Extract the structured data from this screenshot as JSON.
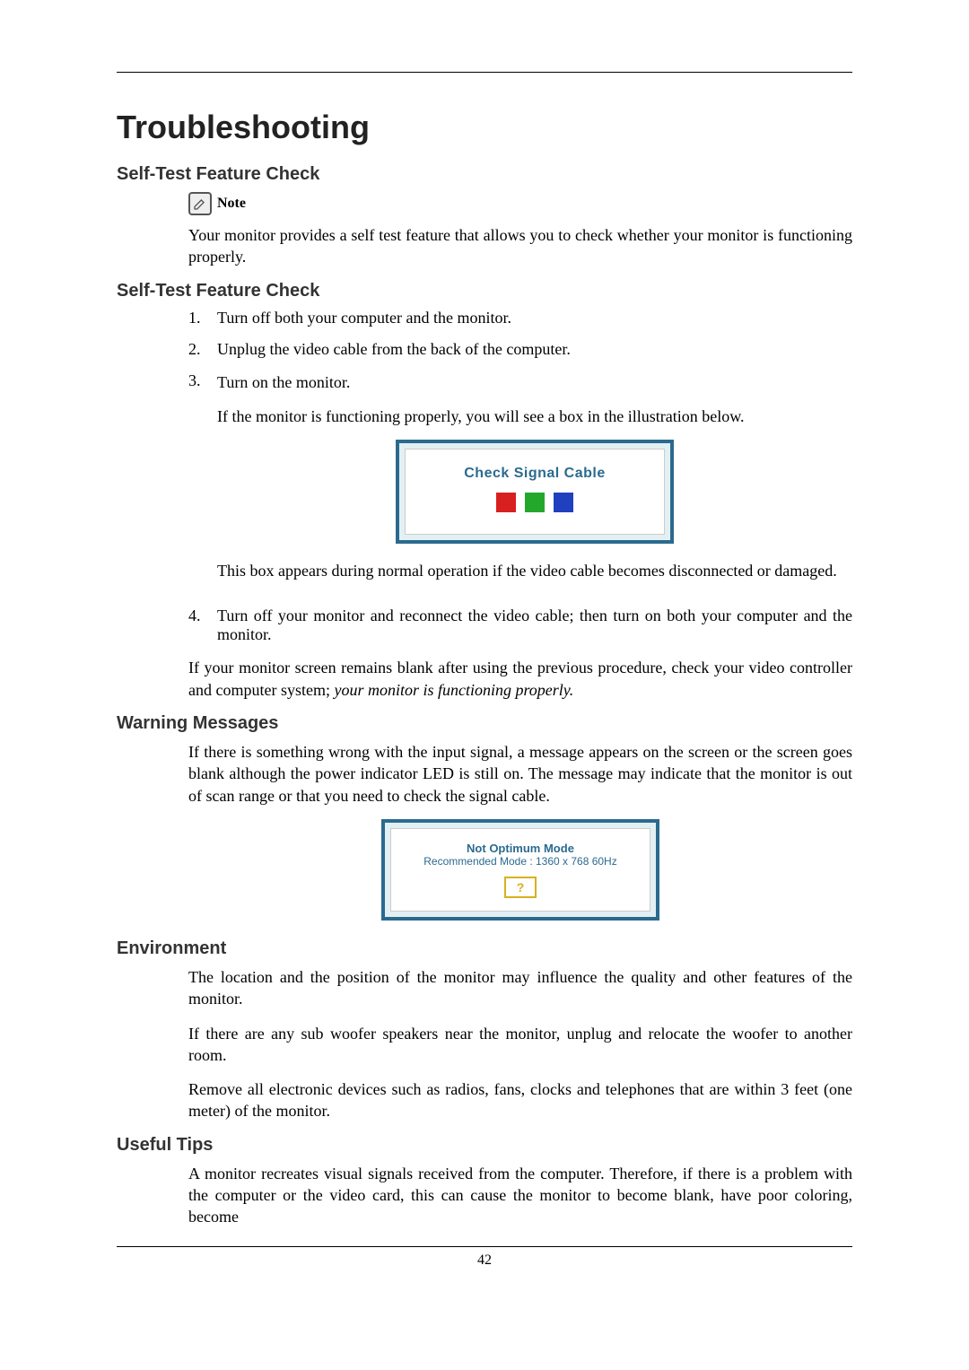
{
  "page": {
    "title": "Troubleshooting",
    "page_number": "42"
  },
  "sections": {
    "s1": {
      "heading": "Self-Test Feature Check",
      "note_label": "Note",
      "note_text": "Your monitor provides a self test feature that allows you to check whether your monitor is functioning properly."
    },
    "s2": {
      "heading": "Self-Test Feature Check",
      "items": {
        "n1": "1.",
        "t1": "Turn off both your computer and the monitor.",
        "n2": "2.",
        "t2": "Unplug the video cable from the back of the computer.",
        "n3": "3.",
        "t3a": "Turn on the monitor.",
        "t3b": "If the monitor is functioning properly, you will see a box in the illustration below.",
        "figure1_text": "Check Signal Cable",
        "t3c": "This box appears during normal operation if the video cable becomes disconnected or damaged.",
        "n4": "4.",
        "t4": "Turn off your monitor and reconnect the video cable; then turn on both your computer and the monitor."
      },
      "closing_a": "If your monitor screen remains blank after using the previous procedure, check your video controller and computer system; ",
      "closing_b": "your monitor is functioning properly."
    },
    "s3": {
      "heading": "Warning Messages",
      "text": "If there is something wrong with the input signal, a message appears on the screen or the screen goes blank although the power indicator LED is still on. The message may indicate that the monitor is out of scan range or that you need to check the signal cable.",
      "figure2_line1": "Not Optimum Mode",
      "figure2_line2": "Recommended Mode : 1360 x 768 60Hz",
      "figure2_qmark": "?"
    },
    "s4": {
      "heading": "Environment",
      "p1": "The location and the position of the monitor may influence the quality and other features of the monitor.",
      "p2": "If there are any sub woofer speakers near the monitor, unplug and relocate the woofer to another room.",
      "p3": "Remove all electronic devices such as radios, fans, clocks and telephones that are within 3 feet (one meter) of the monitor."
    },
    "s5": {
      "heading": "Useful Tips",
      "p1": "A monitor recreates visual signals received from the computer. Therefore, if there is a problem with the computer or the video card, this can cause the monitor to become blank, have poor coloring, become"
    }
  }
}
